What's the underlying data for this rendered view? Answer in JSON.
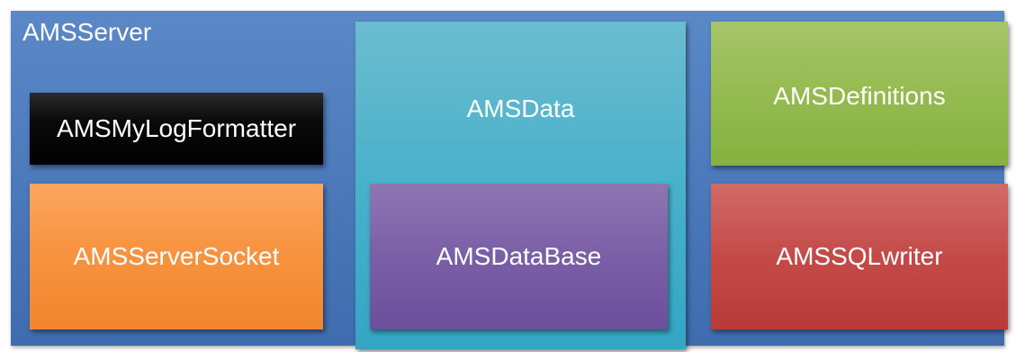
{
  "diagram": {
    "container": {
      "title": "AMSServer",
      "color": "#4a78b9"
    },
    "boxes": {
      "log_formatter": {
        "label": "AMSMyLogFormatter",
        "color": "#000000"
      },
      "server_socket": {
        "label": "AMSServerSocket",
        "color": "#f7923e"
      },
      "data": {
        "label": "AMSData",
        "color": "#49b1cb"
      },
      "database": {
        "label": "AMSDataBase",
        "color": "#7a5fa6"
      },
      "definitions": {
        "label": "AMSDefinitions",
        "color": "#94bb50"
      },
      "sql_writer": {
        "label": "AMSSQLwriter",
        "color": "#c44a48"
      }
    }
  }
}
